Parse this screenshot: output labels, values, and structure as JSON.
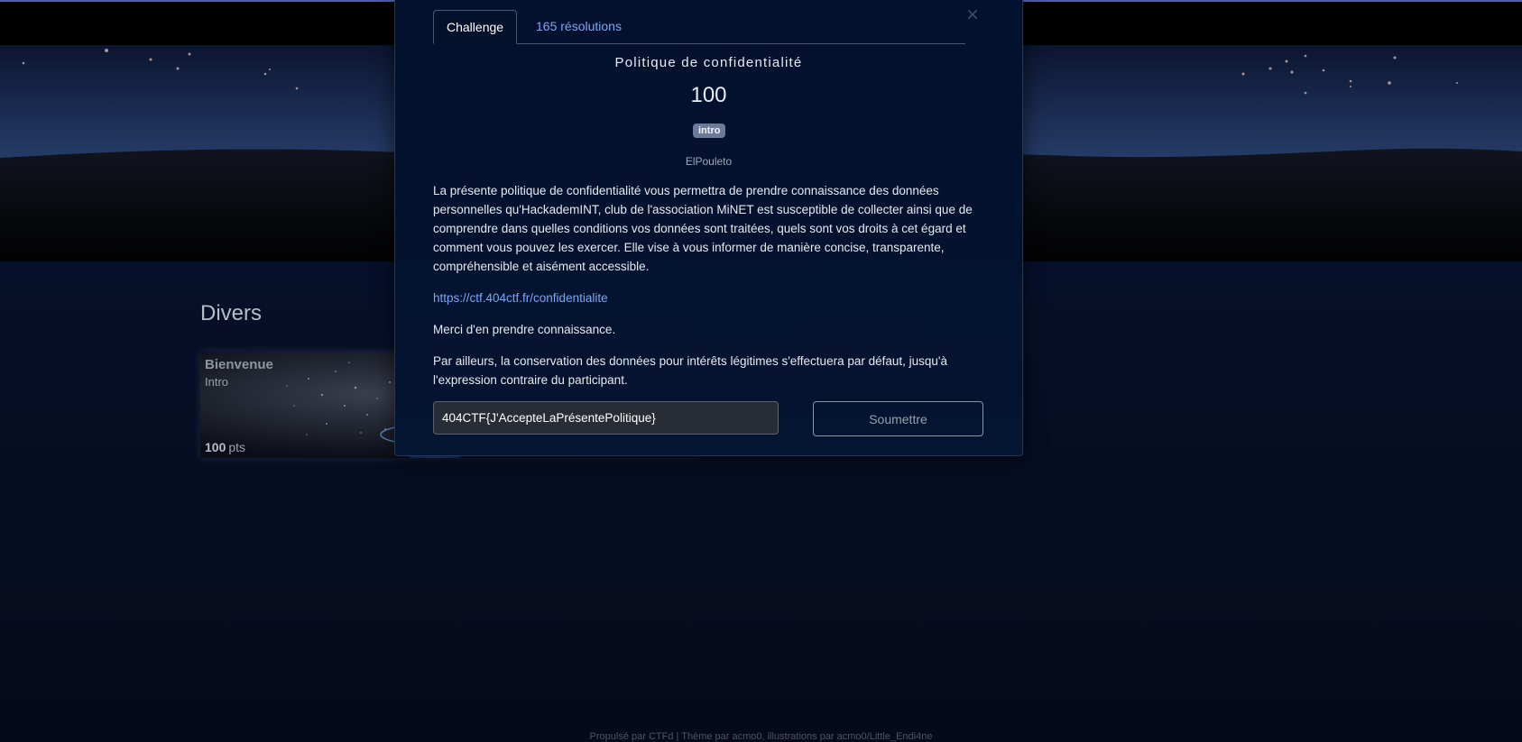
{
  "page": {
    "section_title": "Divers",
    "footer": "Propulsé par CTFd | Thème par acmo0, illustrations par acmo0/Little_Endi4ne"
  },
  "challenge_card": {
    "name": "Bienvenue",
    "category": "Intro",
    "points_value": "100",
    "points_unit": "pts"
  },
  "modal": {
    "tabs": [
      "Challenge",
      "165 résolutions"
    ],
    "close_icon": "close-icon",
    "title": "Politique de confidentialité",
    "value": "100",
    "tag": "intro",
    "author": "ElPouleto",
    "description": [
      "La présente politique de confidentialité vous permettra de prendre connaissance des données personnelles qu'HackademINT, club de l'association MiNET est susceptible de collecter ainsi que de comprendre dans quelles conditions vos données sont traitées, quels sont vos droits à cet égard et comment vous pouvez les exercer. Elle vise à vous informer de manière concise, transparente, compréhensible et aisément accessible.",
      "https://ctf.404ctf.fr/confidentialite",
      "Merci d'en prendre connaissance.",
      "Par ailleurs, la conservation des données pour intérêts légitimes s'effectuera par défaut, jusqu'à l'expression contraire du participant."
    ],
    "flag_input_value": "404CTF{J'AccepteLaPrésentePolitique}",
    "submit_label": "Soumettre"
  },
  "colors": {
    "accent_link": "#7ba5f5",
    "modal_background": "#02112d",
    "page_background": "#050a1a",
    "tag_badge": "#6c7a99"
  }
}
